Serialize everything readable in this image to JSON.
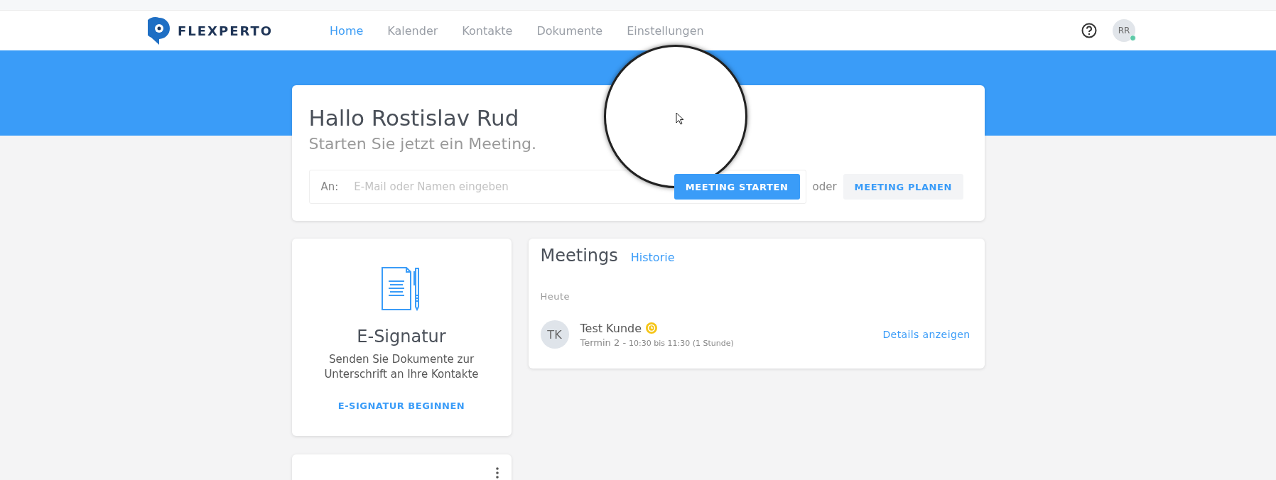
{
  "header": {
    "logo": "FLEXPERTO",
    "nav": [
      {
        "label": "Home",
        "selected": true
      },
      {
        "label": "Kalender",
        "selected": false
      },
      {
        "label": "Kontakte",
        "selected": false
      },
      {
        "label": "Dokumente",
        "selected": false
      },
      {
        "label": "Einstellungen",
        "selected": false
      }
    ],
    "avatar": {
      "initials": "RR",
      "online": true
    }
  },
  "welcome": {
    "title": "Hallo Rostislav Rud",
    "subtitle": "Starten Sie jetzt ein Meeting.",
    "to_label": "An:",
    "placeholder": "E-Mail oder Namen eingeben",
    "start_button": "MEETING STARTEN",
    "or": "oder",
    "plan_button": "MEETING PLANEN"
  },
  "esign_card": {
    "title": "E-Signatur",
    "text": "Senden Sie Dokumente zur Unterschrift an Ihre Kontakte",
    "action": "E-SIGNATUR BEGINNEN"
  },
  "meetings": {
    "title": "Meetings",
    "history_link": "Historie",
    "groups": [
      {
        "label": "Heute",
        "items": [
          {
            "initials": "TK",
            "name": "Test Kunde",
            "appointment": "Termin 2 -",
            "time": "10:30 bis 11:30 (1 Stunde)",
            "action": "Details anzeigen"
          }
        ]
      }
    ]
  }
}
